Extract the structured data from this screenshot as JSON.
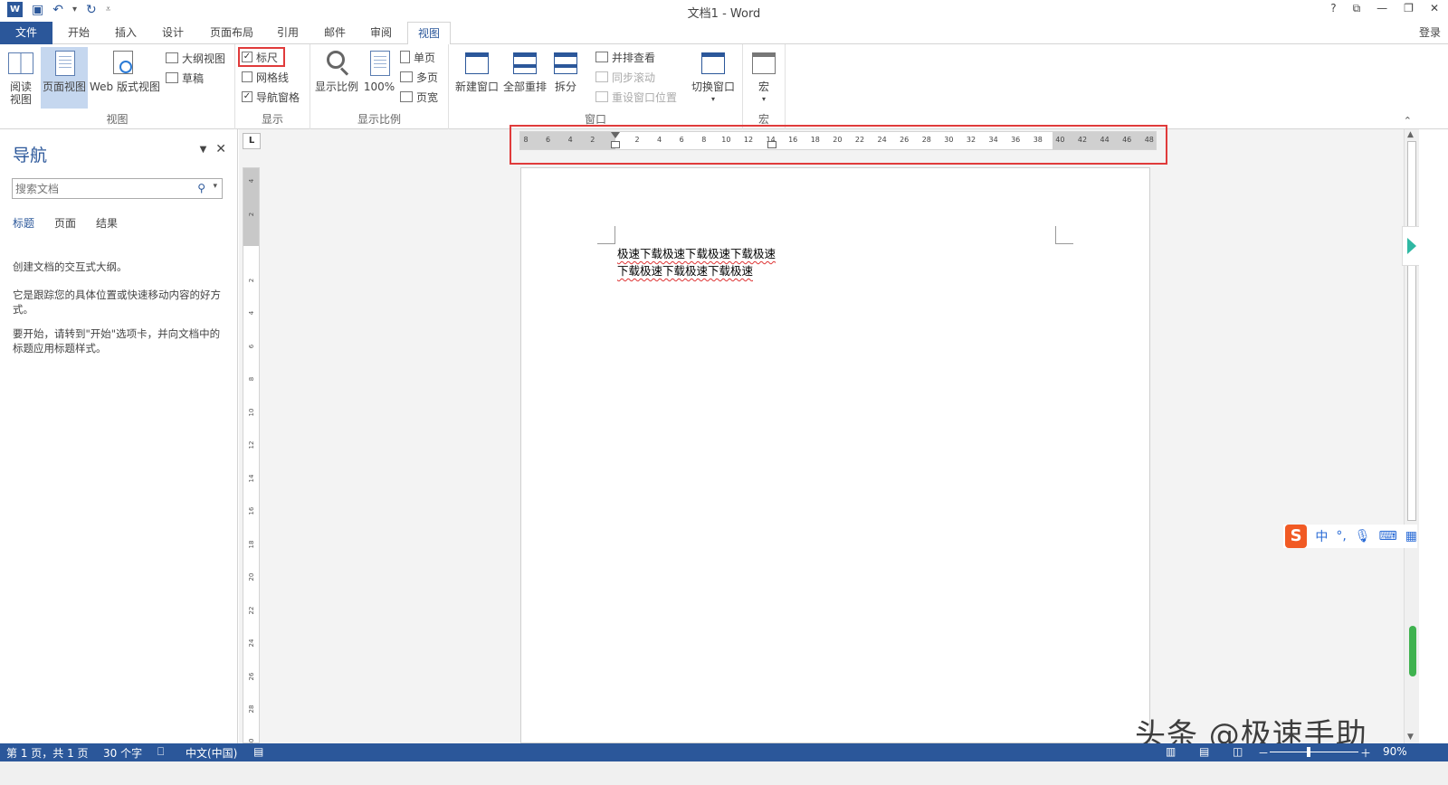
{
  "title_bar": {
    "title": "文档1 - Word",
    "qat": {
      "save_icon": "save-icon",
      "undo_icon": "undo-icon",
      "redo_icon": "redo-icon"
    },
    "window_controls": [
      "?",
      "⧉",
      "—",
      "❐",
      "✕"
    ]
  },
  "tabs": [
    "文件",
    "开始",
    "插入",
    "设计",
    "页面布局",
    "引用",
    "邮件",
    "审阅",
    "视图"
  ],
  "active_tab": "视图",
  "login": "登录",
  "ribbon": {
    "views": {
      "label": "视图",
      "read_mode": "阅读\n视图",
      "print_layout": "页面视图",
      "web_layout": "Web 版式视图",
      "outline": "大纲视图",
      "draft": "草稿"
    },
    "show": {
      "label": "显示",
      "ruler": "标尺",
      "ruler_checked": true,
      "gridlines": "网格线",
      "gridlines_checked": false,
      "nav_pane": "导航窗格",
      "nav_pane_checked": true
    },
    "zoom": {
      "label": "显示比例",
      "zoom": "显示比例",
      "hundred": "100%",
      "one_page": "单页",
      "multi_page": "多页",
      "page_width": "页宽"
    },
    "window": {
      "label": "窗口",
      "new_window": "新建窗口",
      "arrange_all": "全部重排",
      "split": "拆分",
      "side_by_side": "并排查看",
      "sync_scroll": "同步滚动",
      "reset_pos": "重设窗口位置",
      "switch_windows": "切换窗口"
    },
    "macros": {
      "label": "宏",
      "macros": "宏"
    }
  },
  "nav_pane": {
    "title": "导航",
    "search_placeholder": "搜索文档",
    "tabs": [
      "标题",
      "页面",
      "结果"
    ],
    "p1": "创建文档的交互式大纲。",
    "p2": "它是跟踪您的具体位置或快速移动内容的好方式。",
    "p3": "要开始，请转到\"开始\"选项卡，并向文档中的标题应用标题样式。"
  },
  "ruler": {
    "corner": "L",
    "h_ticks": [
      "8",
      "6",
      "4",
      "2",
      "",
      "2",
      "4",
      "6",
      "8",
      "10",
      "12",
      "14",
      "16",
      "18",
      "20",
      "22",
      "24",
      "26",
      "28",
      "30",
      "32",
      "34",
      "36",
      "38",
      "40",
      "42",
      "44",
      "46",
      "48"
    ],
    "v_ticks": [
      "4",
      "2",
      "",
      "2",
      "4",
      "6",
      "8",
      "10",
      "12",
      "14",
      "16",
      "18",
      "20",
      "22",
      "24",
      "26",
      "28",
      "30"
    ]
  },
  "document": {
    "text": "极速下载极速下载极速下载极速下载极速下载极速下载极速"
  },
  "ime": {
    "logo": "S",
    "lang": "中",
    "punct": "°,",
    "mic": "🎙",
    "kbd": "⌨",
    "grid": "▦"
  },
  "watermark": "头条 @极速手助",
  "status": {
    "page": "第 1 页，共 1 页",
    "words": "30 个字",
    "lang": "中文(中国)",
    "zoom": "90%",
    "zoom_minus": "－",
    "zoom_plus": "＋"
  }
}
